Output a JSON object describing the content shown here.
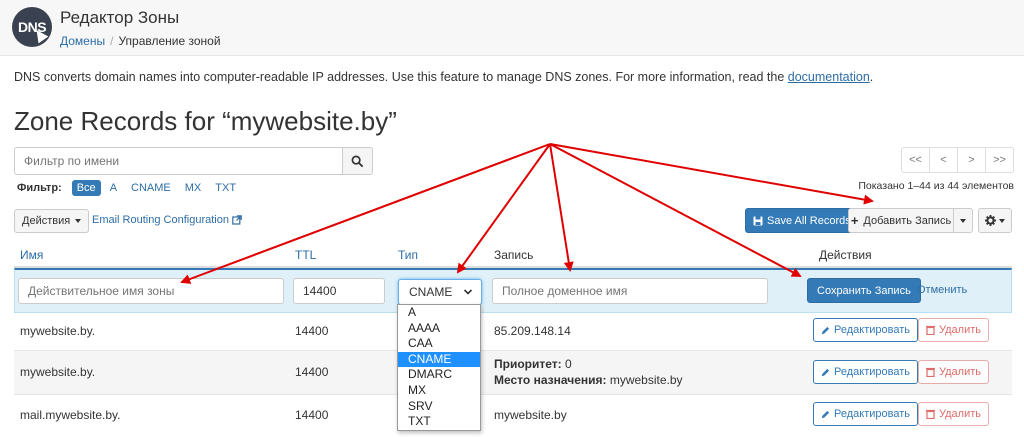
{
  "header": {
    "logo_text": "DNS",
    "title": "Редактор Зоны",
    "breadcrumb_link": "Домены",
    "breadcrumb_sep": "/",
    "breadcrumb_current": "Управление зоной"
  },
  "description": {
    "text": "DNS converts domain names into computer-readable IP addresses. Use this feature to manage DNS zones. For more information, read the ",
    "link": "documentation",
    "tail": "."
  },
  "page_title": "Zone Records for “mywebsite.by”",
  "filter": {
    "placeholder": "Фильтр по имени",
    "label": "Фильтр:",
    "types": [
      "Все",
      "A",
      "CNAME",
      "MX",
      "TXT"
    ]
  },
  "pager": {
    "first": "<<",
    "prev": "<",
    "next": ">",
    "last": ">>",
    "shown": "Показано 1–44 из 44 элементов"
  },
  "toolbar": {
    "actions": "Действия",
    "email_routing": "Email Routing Configuration",
    "save_all": "Save All Records",
    "add_record": "Добавить Запись"
  },
  "table": {
    "headers": {
      "name": "Имя",
      "ttl": "TTL",
      "type": "Тип",
      "record": "Запись",
      "actions": "Действия"
    },
    "edit_row": {
      "name_placeholder": "Действительное имя зоны",
      "ttl_value": "14400",
      "type_value": "CNAME",
      "record_placeholder": "Полное доменное имя",
      "save": "Сохранить Запись",
      "cancel": "Отменить"
    },
    "rows": [
      {
        "name": "mywebsite.by.",
        "ttl": "14400",
        "record": "85.209.148.14"
      },
      {
        "name": "mywebsite.by.",
        "ttl": "14400",
        "priority_label": "Приоритет:",
        "priority": "0",
        "dest_label": "Место назначения:",
        "dest": "mywebsite.by"
      },
      {
        "name": "mail.mywebsite.by.",
        "ttl": "14400",
        "record": "mywebsite.by"
      }
    ],
    "edit_label": "Редактировать",
    "delete_label": "Удалить"
  },
  "type_options": [
    "A",
    "AAAA",
    "CAA",
    "CNAME",
    "DMARC",
    "MX",
    "SRV",
    "TXT"
  ],
  "type_selected_index": 3,
  "colors": {
    "link": "#2e6da4",
    "primary": "#337ab7",
    "danger": "#d9534f",
    "annotation_arrow": "#e00000"
  }
}
